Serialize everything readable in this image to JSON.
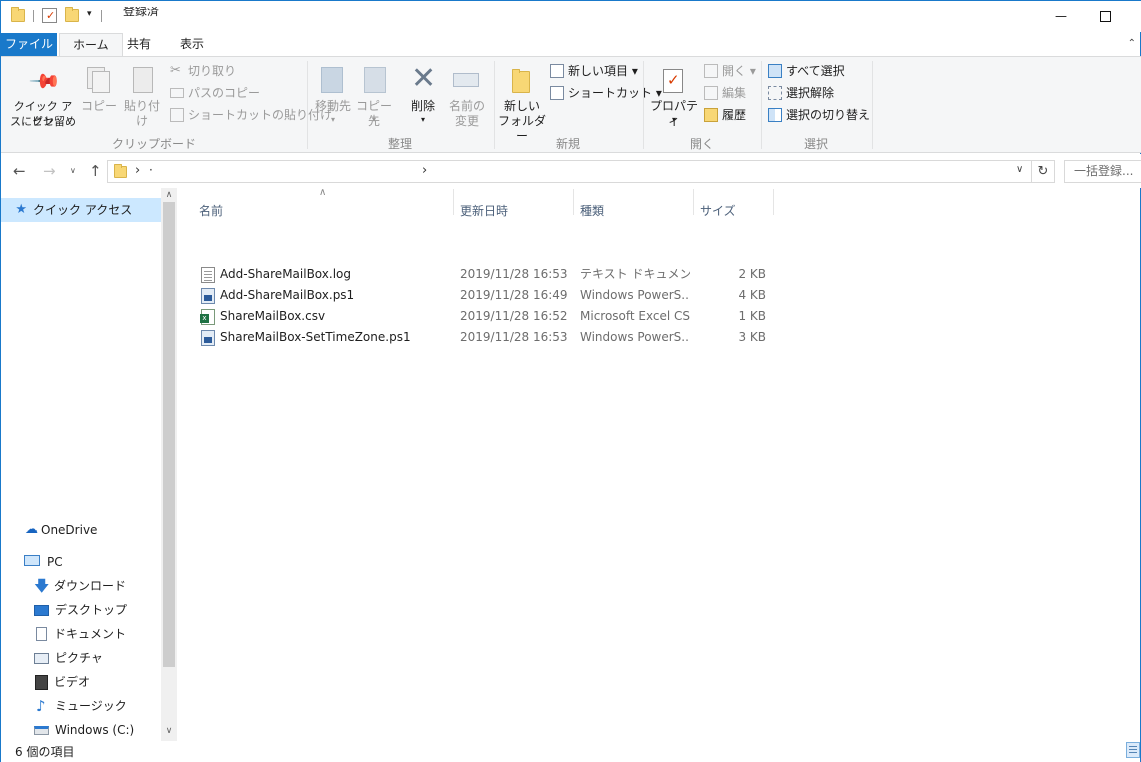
{
  "titlebar": {
    "title": "登録済",
    "minimize_glyph": "—",
    "maximize_glyph": "□"
  },
  "ribbon_tabs": [
    {
      "label": "ファイル"
    },
    {
      "label": "ホーム"
    },
    {
      "label": "共有"
    },
    {
      "label": "表示"
    }
  ],
  "ribbon": {
    "clipboard": {
      "pin_label_1": "クイック アクセ",
      "pin_label_2": "スにピン留め",
      "copy_label": "コピー",
      "paste_label": "貼り付け",
      "cut_label": "切り取り",
      "copy_path_label": "パスのコピー",
      "paste_shortcut_label": "ショートカットの貼り付け",
      "group_label": "クリップボード"
    },
    "organize": {
      "move_label": "移動先",
      "copyto_label": "コピー先",
      "delete_label": "削除",
      "rename_label_1": "名前の",
      "rename_label_2": "変更",
      "group_label": "整理"
    },
    "new": {
      "newfolder_label_1": "新しい",
      "newfolder_label_2": "フォルダー",
      "newitem_label": "新しい項目 ▾",
      "shortcut_label": "ショートカット ▾",
      "group_label": "新規"
    },
    "open": {
      "properties_label": "プロパティ",
      "open_label": "開く ▾",
      "edit_label": "編集",
      "history_label": "履歴",
      "group_label": "開く"
    },
    "select": {
      "selectall_label": "すべて選択",
      "selectnone_label": "選択解除",
      "invert_label": "選択の切り替え",
      "group_label": "選択"
    }
  },
  "address": {
    "path_chevron": "›",
    "path_dot": "·",
    "mid_chevron": "›",
    "search_placeholder": "一括登録..."
  },
  "navpane": {
    "quick_access": "クイック アクセス",
    "onedrive": "OneDrive",
    "pc": "PC",
    "downloads": "ダウンロード",
    "desktop": "デスクトップ",
    "documents": "ドキュメント",
    "pictures": "ピクチャ",
    "videos": "ビデオ",
    "music": "ミュージック",
    "windows_c": "Windows (C:)"
  },
  "columns": {
    "name": "名前",
    "modified": "更新日時",
    "type": "種類",
    "size": "サイズ"
  },
  "files": [
    {
      "name": "Add-ShareMailBox.log",
      "modified": "2019/11/28 16:53",
      "type": "テキスト ドキュメント",
      "size": "2 KB",
      "icon": "text-file-icon"
    },
    {
      "name": "Add-ShareMailBox.ps1",
      "modified": "2019/11/28 16:49",
      "type": "Windows PowerS...",
      "size": "4 KB",
      "icon": "powershell-file-icon"
    },
    {
      "name": "ShareMailBox.csv",
      "modified": "2019/11/28 16:52",
      "type": "Microsoft Excel CS...",
      "size": "1 KB",
      "icon": "excel-file-icon"
    },
    {
      "name": "ShareMailBox-SetTimeZone.ps1",
      "modified": "2019/11/28 16:53",
      "type": "Windows PowerS...",
      "size": "3 KB",
      "icon": "powershell-file-icon"
    }
  ],
  "status": {
    "item_count": "6 個の項目"
  }
}
